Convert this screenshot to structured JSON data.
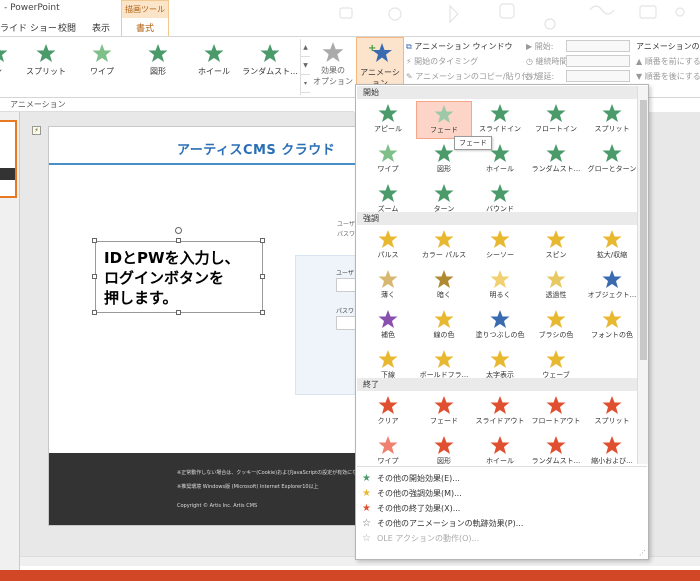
{
  "app": {
    "title": "- PowerPoint"
  },
  "context_group": {
    "label": "描画ツール"
  },
  "tabs": [
    {
      "label": "ライド ショー"
    },
    {
      "label": "校閲"
    },
    {
      "label": "表示"
    },
    {
      "label": "書式"
    }
  ],
  "ribbon": {
    "gallery": [
      {
        "label": "ン",
        "color": "#6ab04c"
      },
      {
        "label": "スプリット",
        "color": "#4a9a6a"
      },
      {
        "label": "ワイプ",
        "color": "#7fc08a"
      },
      {
        "label": "図形",
        "color": "#4a9a6a"
      },
      {
        "label": "ホイール",
        "color": "#4a9a6a"
      },
      {
        "label": "ランダムスト...",
        "color": "#4a9a6a"
      }
    ],
    "effect_options": "効果の\nオプション",
    "add_animation": "アニメーション\nの追加",
    "animation_window": "アニメーション ウィンドウ",
    "trigger": "開始のタイミング",
    "copy_paste": "アニメーションのコピー/貼り付け",
    "start_label": "開始:",
    "duration_label": "継続時間:",
    "delay_label": "遅延:",
    "order_header": "アニメーションの順序",
    "move_earlier": "順番を前にする",
    "move_later": "順番を後にする",
    "group_label": "アニメーション"
  },
  "slide": {
    "logo": "アーティスCMS クラウド",
    "callout": "IDとPWを入力し、ログインボタンを押します。",
    "callout_lines": [
      "IDとPWを入力し、",
      "ログインボタンを",
      "押します。"
    ],
    "form_label_user": "ユーザ",
    "form_label_pass": "パスワ",
    "form_top_user": "ユーザ",
    "form_top_pass": "パスワ",
    "footer_line1": "※正常動作しない場合は、クッキー(Cookie)およびJavaScriptの設定が有効になっているか確認してください",
    "footer_line2": "※推奨環境 Windows版 (Microsoft) Internet Explorer10以上",
    "copyright": "Copyright © Artis Inc. Artis CMS"
  },
  "dropdown": {
    "sections": [
      {
        "title": "開始",
        "items": [
          {
            "label": "アピール",
            "color": "#4a9a6a"
          },
          {
            "label": "フェード",
            "color": "#9ec9a8",
            "selected": true
          },
          {
            "label": "スライドイン",
            "color": "#4a9a6a"
          },
          {
            "label": "フロートイン",
            "color": "#4a9a6a"
          },
          {
            "label": "スプリット",
            "color": "#4a9a6a"
          },
          {
            "label": "ワイプ",
            "color": "#7fc08a"
          },
          {
            "label": "図形",
            "color": "#4a9a6a"
          },
          {
            "label": "ホイール",
            "color": "#4a9a6a"
          },
          {
            "label": "ランダムスト...",
            "color": "#4a9a6a"
          },
          {
            "label": "グローとターン",
            "color": "#4a9a6a"
          },
          {
            "label": "ズーム",
            "color": "#4a9a6a"
          },
          {
            "label": "ターン",
            "color": "#4a9a6a"
          },
          {
            "label": "バウンド",
            "color": "#4a9a6a"
          }
        ]
      },
      {
        "title": "強調",
        "items": [
          {
            "label": "パルス",
            "color": "#e8b830"
          },
          {
            "label": "カラー パルス",
            "color": "#e8b830"
          },
          {
            "label": "シーソー",
            "color": "#e8b830"
          },
          {
            "label": "スピン",
            "color": "#e8b830"
          },
          {
            "label": "拡大/収縮",
            "color": "#e8b830"
          },
          {
            "label": "薄く",
            "color": "#d8b870"
          },
          {
            "label": "暗く",
            "color": "#b08a30"
          },
          {
            "label": "明るく",
            "color": "#f0d070"
          },
          {
            "label": "透過性",
            "color": "#e8c860"
          },
          {
            "label": "オブジェクト...",
            "color": "#3a6ab0"
          },
          {
            "label": "補色",
            "color": "#8a50b0"
          },
          {
            "label": "線の色",
            "color": "#e8b830"
          },
          {
            "label": "塗りつぶしの色",
            "color": "#3a6ab0"
          },
          {
            "label": "ブラシの色",
            "color": "#e8b830"
          },
          {
            "label": "フォントの色",
            "color": "#e8b830"
          },
          {
            "label": "下線",
            "color": "#e8b830"
          },
          {
            "label": "ボールドフラ...",
            "color": "#e8b830"
          },
          {
            "label": "太字表示",
            "color": "#e8b830"
          },
          {
            "label": "ウェーブ",
            "color": "#e8b830"
          }
        ]
      },
      {
        "title": "終了",
        "items": [
          {
            "label": "クリア",
            "color": "#e05030"
          },
          {
            "label": "フェード",
            "color": "#e05030"
          },
          {
            "label": "スライドアウト",
            "color": "#e05030"
          },
          {
            "label": "フロートアウト",
            "color": "#e05030"
          },
          {
            "label": "スプリット",
            "color": "#e05030"
          },
          {
            "label": "ワイプ",
            "color": "#f08070"
          },
          {
            "label": "図形",
            "color": "#e05030"
          },
          {
            "label": "ホイール",
            "color": "#e05030"
          },
          {
            "label": "ランダムスト...",
            "color": "#e05030"
          },
          {
            "label": "縮小および...",
            "color": "#e05030"
          }
        ]
      }
    ],
    "tooltip": "フェード",
    "more": [
      {
        "label": "その他の開始効果(E)...",
        "color": "#4a9a6a",
        "disabled": false
      },
      {
        "label": "その他の強調効果(M)...",
        "color": "#e8b830",
        "disabled": false
      },
      {
        "label": "その他の終了効果(X)...",
        "color": "#e05030",
        "disabled": false
      },
      {
        "label": "その他のアニメーションの軌跡効果(P)...",
        "color": "#666666",
        "disabled": false
      },
      {
        "label": "OLE アクションの動作(O)...",
        "color": "#aaaaaa",
        "disabled": true
      }
    ]
  }
}
